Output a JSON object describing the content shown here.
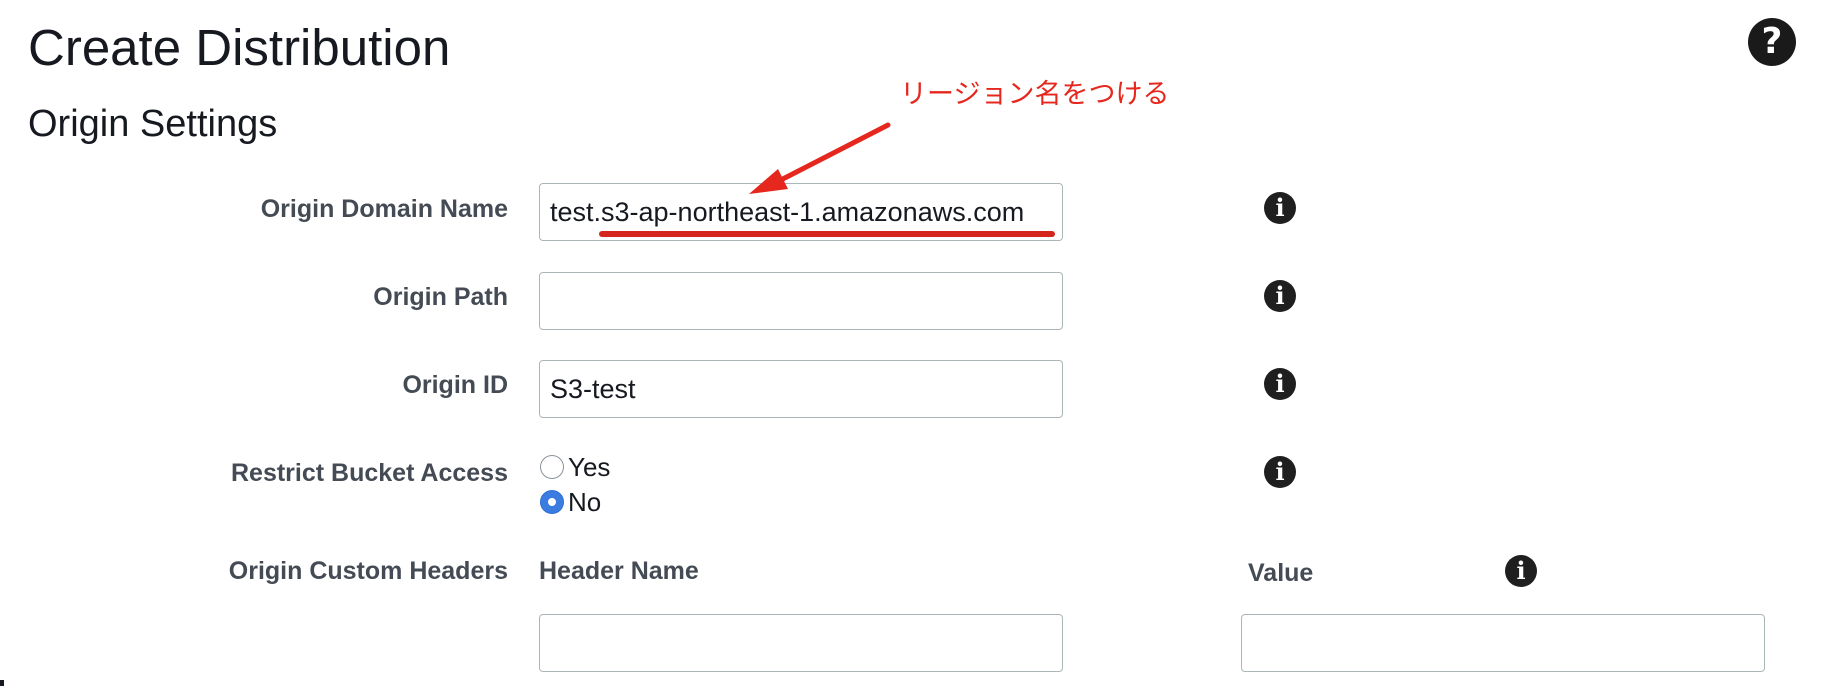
{
  "page": {
    "title": "Create Distribution",
    "help_icon": "question-circle-icon",
    "help_glyph": "?"
  },
  "origin_settings": {
    "section_title": "Origin Settings",
    "info_icon": "info-circle-icon",
    "info_glyph": "i",
    "origin_domain_name": {
      "label": "Origin Domain Name",
      "value": "test.s3-ap-northeast-1.amazonaws.com"
    },
    "origin_path": {
      "label": "Origin Path",
      "value": ""
    },
    "origin_id": {
      "label": "Origin ID",
      "value": "S3-test"
    },
    "restrict_bucket_access": {
      "label": "Restrict Bucket Access",
      "options": [
        "Yes",
        "No"
      ],
      "selected": "No"
    },
    "origin_custom_headers": {
      "label": "Origin Custom Headers",
      "header_name_label": "Header Name",
      "value_label": "Value",
      "header_name_value": "",
      "value_value": ""
    }
  },
  "annotation": {
    "text": "リージョン名をつける",
    "color": "#e5271e"
  },
  "colors": {
    "label": "#444b54",
    "input_border": "#aab7b8",
    "radio_selected": "#3b7ce0"
  }
}
